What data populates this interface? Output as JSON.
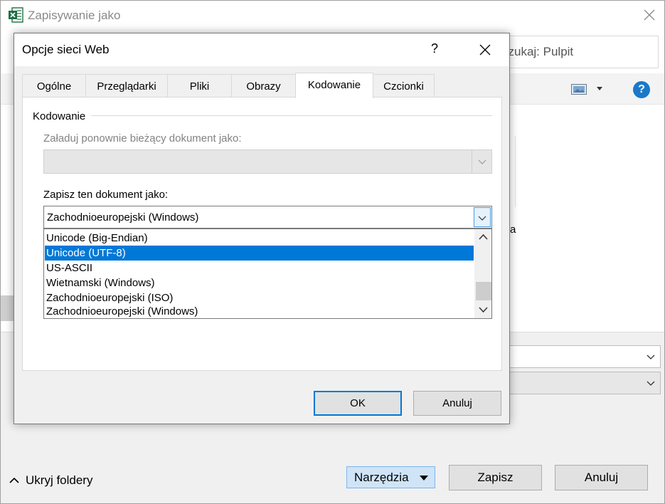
{
  "outer": {
    "title": "Zapisywanie jako",
    "search_text": "szukaj: Pulpit",
    "help_glyph": "?",
    "file_label_fragment": "a",
    "hide_folders_label": "Ukryj foldery",
    "tools_label": "Narzędzia",
    "save_label": "Zapisz",
    "cancel_label": "Anuluj"
  },
  "dialog": {
    "title": "Opcje sieci Web",
    "help_glyph": "?",
    "tabs": [
      {
        "label": "Ogólne"
      },
      {
        "label": "Przeglądarki"
      },
      {
        "label": "Pliki"
      },
      {
        "label": "Obrazy"
      },
      {
        "label": "Kodowanie",
        "active": true
      },
      {
        "label": "Czcionki"
      }
    ],
    "group_label": "Kodowanie",
    "reload_label": "Załaduj ponownie bieżący dokument jako:",
    "save_as_label": "Zapisz ten dokument jako:",
    "save_as_value": "Zachodnioeuropejski (Windows)",
    "encoding_options": [
      {
        "label": "Unicode (Big-Endian)"
      },
      {
        "label": "Unicode (UTF-8)",
        "selected": true
      },
      {
        "label": "US-ASCII"
      },
      {
        "label": "Wietnamski (Windows)"
      },
      {
        "label": "Zachodnioeuropejski (ISO)"
      },
      {
        "label": "Zachodnioeuropejski (Windows)"
      }
    ],
    "ok_label": "OK",
    "cancel_label": "Anuluj"
  },
  "colors": {
    "selection": "#0078d7",
    "tools_button_bg": "#cfe4f7",
    "help_icon": "#1979ca",
    "excel_green": "#1d6f42"
  },
  "icons": {
    "app": "excel-icon",
    "close": "close-icon",
    "view": "view-options-icon",
    "help": "help-icon"
  }
}
